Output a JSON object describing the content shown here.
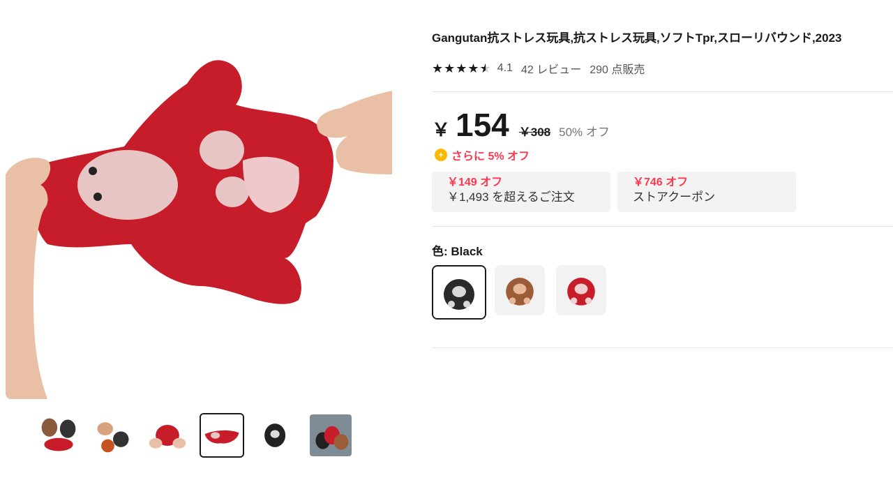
{
  "product": {
    "title": "Gangutan抗ストレス玩具,抗ストレス玩具,ソフトTpr,スローリバウンド,2023",
    "rating_value": "4.1",
    "reviews": "42 レビュー",
    "sold": "290 点販売"
  },
  "price": {
    "currency": "￥",
    "current": "154",
    "original": "￥308",
    "discount": "50% オフ"
  },
  "extra_discount": "さらに 5% オフ",
  "coupons": [
    {
      "amount": "￥149 オフ",
      "desc": "￥1,493 を超えるご注文"
    },
    {
      "amount": "￥746 オフ",
      "desc": "ストアクーポン"
    }
  ],
  "color": {
    "label": "色: Black"
  },
  "colors": {
    "accent": "#fd384f",
    "coin": "#ffb800"
  }
}
